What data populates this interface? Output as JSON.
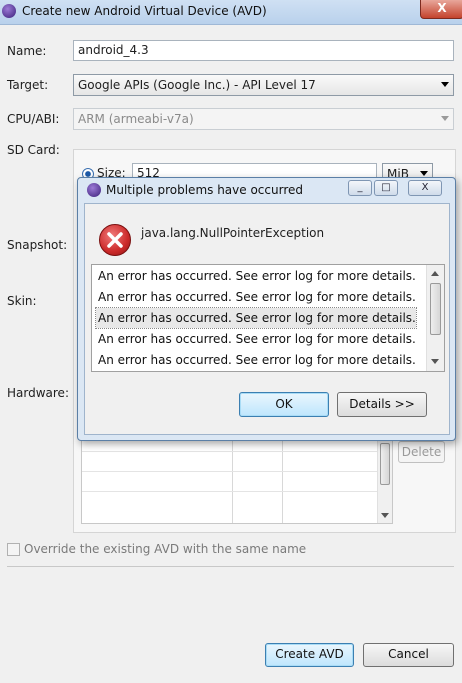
{
  "window": {
    "title": "Create new Android Virtual Device (AVD)",
    "close_glyph": "X"
  },
  "form": {
    "name_label": "Name:",
    "name_value": "android_4.3",
    "target_label": "Target:",
    "target_value": "Google APIs (Google Inc.) - API Level 17",
    "cpu_label": "CPU/ABI:",
    "cpu_value": "ARM (armeabi-v7a)",
    "sdcard_label": "SD Card:",
    "size_label": "Size:",
    "size_value": "512",
    "size_unit": "MiB",
    "snapshot_label": "Snapshot:",
    "skin_label": "Skin:",
    "hardware_label": "Hardware:",
    "delete_button": "Delete",
    "override_label": "Override the existing AVD with the same name"
  },
  "footer": {
    "create_button": "Create AVD",
    "cancel_button": "Cancel"
  },
  "dialog": {
    "title": "Multiple problems have occurred",
    "exception": "java.lang.NullPointerException",
    "errors": [
      "An error has occurred. See error log for more details.",
      "An error has occurred. See error log for more details.",
      "An error has occurred. See error log for more details.",
      "An error has occurred. See error log for more details.",
      "An error has occurred. See error log for more details."
    ],
    "ok_button": "OK",
    "details_button": "Details >>",
    "minimize_glyph": "_",
    "maximize_glyph": "□",
    "close_glyph": "X"
  },
  "colors": {
    "error_icon": "#cc2a2a",
    "title_bar": "#c6daf1",
    "dialog_frame": "#dbe7f4"
  }
}
